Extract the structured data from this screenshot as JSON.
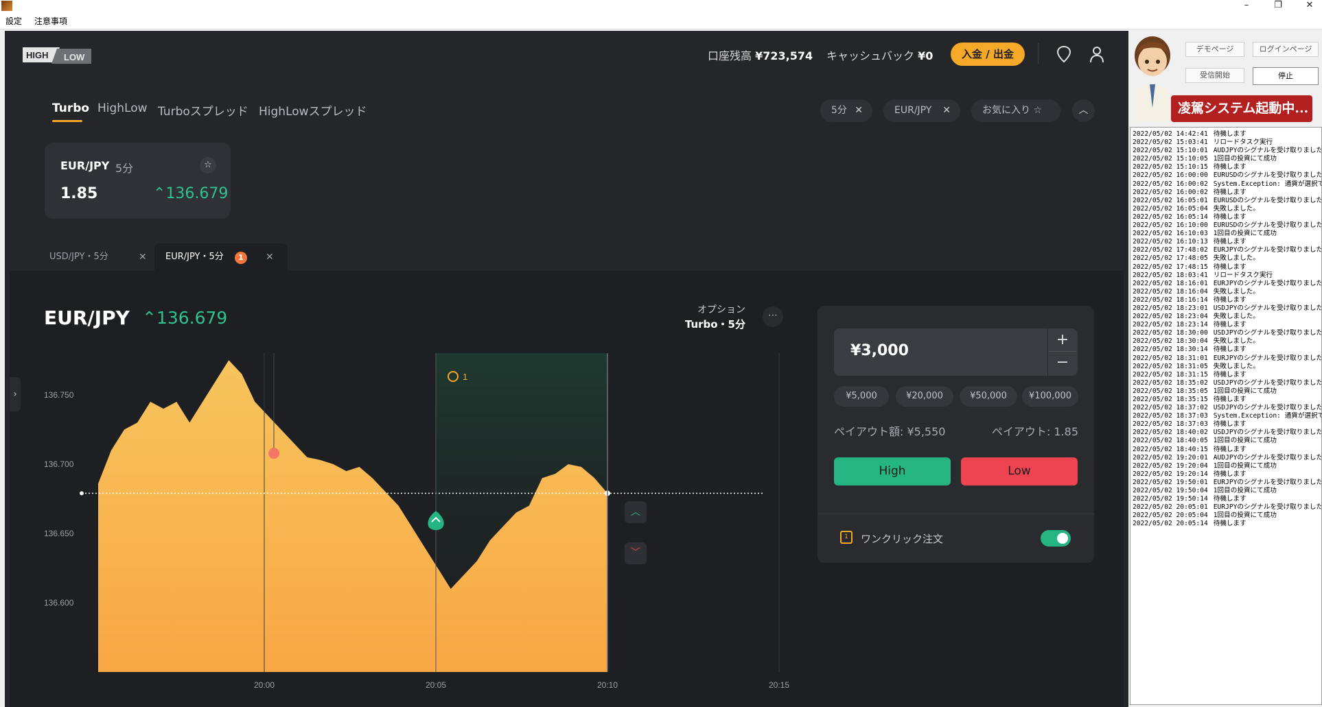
{
  "window": {
    "minimize": "–",
    "restore": "❐",
    "close": "✕"
  },
  "menu": {
    "items": [
      "設定",
      "注意事項"
    ]
  },
  "header": {
    "logo_high": "HIGH",
    "logo_low": "LOW",
    "balance_label": "口座残高",
    "balance_value": "¥723,574",
    "cashback_label": "キャッシュバック",
    "cashback_value": "¥0",
    "deposit_button": "入金 / 出金",
    "icons": [
      "location-icon",
      "user-icon"
    ]
  },
  "product_tabs": [
    "Turbo",
    "HighLow",
    "Turboスプレッド",
    "HighLowスプレッド"
  ],
  "filter_chips": [
    "5分",
    "EUR/JPY",
    "お気に入り ☆"
  ],
  "favorite_card": {
    "pair": "EUR/JPY",
    "duration": "5分",
    "payout": "1.85",
    "price": "136.679",
    "direction": "up"
  },
  "chart_tabs": [
    {
      "label": "USD/JPY・5分",
      "badge": ""
    },
    {
      "label": "EUR/JPY・5分",
      "badge": "1"
    }
  ],
  "chart_header": {
    "pair": "EUR/JPY",
    "price": "136.679",
    "option_label": "オプション",
    "option_value": "Turbo・5分"
  },
  "chart_data": {
    "type": "area",
    "x_ticks": [
      "20:00",
      "20:05",
      "20:10",
      "20:15"
    ],
    "y_ticks": [
      "136.750",
      "136.700",
      "136.650",
      "136.600"
    ],
    "ylim": [
      136.55,
      136.79
    ],
    "series": [
      {
        "values": [
          136.686,
          136.71,
          136.725,
          136.73,
          136.745,
          136.74,
          136.745,
          136.73,
          136.745,
          136.76,
          136.775,
          136.765,
          136.745,
          136.735,
          136.725,
          136.715,
          136.705,
          136.703,
          136.7,
          136.695,
          136.698,
          136.69,
          136.68,
          136.67,
          136.655,
          136.64,
          136.625,
          136.61,
          136.62,
          136.63,
          136.645,
          136.655,
          136.665,
          136.67,
          136.69,
          136.693,
          136.7,
          136.698,
          136.69,
          136.679
        ]
      }
    ],
    "current_price": 136.679,
    "trade_marker": "1",
    "colors": {
      "area_top": "#f7c45d",
      "area_bottom": "#f7a83c",
      "up": "#25b583",
      "down": "#ee4452"
    }
  },
  "ticket": {
    "amount": "¥3,000",
    "plus": "+",
    "minus": "−",
    "presets": [
      "¥5,000",
      "¥20,000",
      "¥50,000",
      "¥100,000"
    ],
    "payout_amount": "ペイアウト額: ¥5,550",
    "payout_rate": "ペイアウト: 1.85",
    "high": "High",
    "low": "Low",
    "oneclick": "ワンクリック注文"
  },
  "tool": {
    "buttons": [
      "デモページ",
      "ログインページ",
      "受信開始",
      "停止"
    ],
    "banner": "凌駕システム起動中...",
    "log": [
      [
        "2022/05/02 14:42:41",
        "待機します"
      ],
      [
        "2022/05/02 15:03:41",
        "リロードタスク実行"
      ],
      [
        "2022/05/02 15:10:01",
        "AUDJPYのシグナルを受け取りました"
      ],
      [
        "2022/05/02 15:10:05",
        "1回目の投資にて成功"
      ],
      [
        "2022/05/02 15:10:15",
        "待機します"
      ],
      [
        "2022/05/02 16:00:00",
        "EURUSDのシグナルを受け取りました"
      ],
      [
        "2022/05/02 16:00:02",
        "System.Exception: 通貨が選択できません"
      ],
      [
        "2022/05/02 16:00:02",
        "待機します"
      ],
      [
        "2022/05/02 16:05:01",
        "EURUSDのシグナルを受け取りました"
      ],
      [
        "2022/05/02 16:05:04",
        "失敗しました。"
      ],
      [
        "2022/05/02 16:05:14",
        "待機します"
      ],
      [
        "2022/05/02 16:10:00",
        "EURUSDのシグナルを受け取りました"
      ],
      [
        "2022/05/02 16:10:03",
        "1回目の投資にて成功"
      ],
      [
        "2022/05/02 16:10:13",
        "待機します"
      ],
      [
        "2022/05/02 17:48:02",
        "EURJPYのシグナルを受け取りました"
      ],
      [
        "2022/05/02 17:48:05",
        "失敗しました。"
      ],
      [
        "2022/05/02 17:48:15",
        "待機します"
      ],
      [
        "2022/05/02 18:03:41",
        "リロードタスク実行"
      ],
      [
        "2022/05/02 18:16:01",
        "EURJPYのシグナルを受け取りました"
      ],
      [
        "2022/05/02 18:16:04",
        "失敗しました。"
      ],
      [
        "2022/05/02 18:16:14",
        "待機します"
      ],
      [
        "2022/05/02 18:23:01",
        "USDJPYのシグナルを受け取りました"
      ],
      [
        "2022/05/02 18:23:04",
        "失敗しました。"
      ],
      [
        "2022/05/02 18:23:14",
        "待機します"
      ],
      [
        "2022/05/02 18:30:00",
        "USDJPYのシグナルを受け取りました"
      ],
      [
        "2022/05/02 18:30:04",
        "失敗しました。"
      ],
      [
        "2022/05/02 18:30:14",
        "待機します"
      ],
      [
        "2022/05/02 18:31:01",
        "EURJPYのシグナルを受け取りました"
      ],
      [
        "2022/05/02 18:31:05",
        "失敗しました。"
      ],
      [
        "2022/05/02 18:31:15",
        "待機します"
      ],
      [
        "2022/05/02 18:35:02",
        "USDJPYのシグナルを受け取りました"
      ],
      [
        "2022/05/02 18:35:05",
        "1回目の投資にて成功"
      ],
      [
        "2022/05/02 18:35:15",
        "待機します"
      ],
      [
        "2022/05/02 18:37:02",
        "USDJPYのシグナルを受け取りました"
      ],
      [
        "2022/05/02 18:37:03",
        "System.Exception: 通貨が選択できません"
      ],
      [
        "2022/05/02 18:37:03",
        "待機します"
      ],
      [
        "2022/05/02 18:40:02",
        "USDJPYのシグナルを受け取りました"
      ],
      [
        "2022/05/02 18:40:05",
        "1回目の投資にて成功"
      ],
      [
        "2022/05/02 18:40:15",
        "待機します"
      ],
      [
        "2022/05/02 19:20:01",
        "AUDJPYのシグナルを受け取りました"
      ],
      [
        "2022/05/02 19:20:04",
        "1回目の投資にて成功"
      ],
      [
        "2022/05/02 19:20:14",
        "待機します"
      ],
      [
        "2022/05/02 19:50:01",
        "EURJPYのシグナルを受け取りました"
      ],
      [
        "2022/05/02 19:50:04",
        "1回目の投資にて成功"
      ],
      [
        "2022/05/02 19:50:14",
        "待機します"
      ],
      [
        "2022/05/02 20:05:01",
        "EURJPYのシグナルを受け取りました"
      ],
      [
        "2022/05/02 20:05:04",
        "1回目の投資にて成功"
      ],
      [
        "2022/05/02 20:05:14",
        "待機します"
      ]
    ]
  }
}
